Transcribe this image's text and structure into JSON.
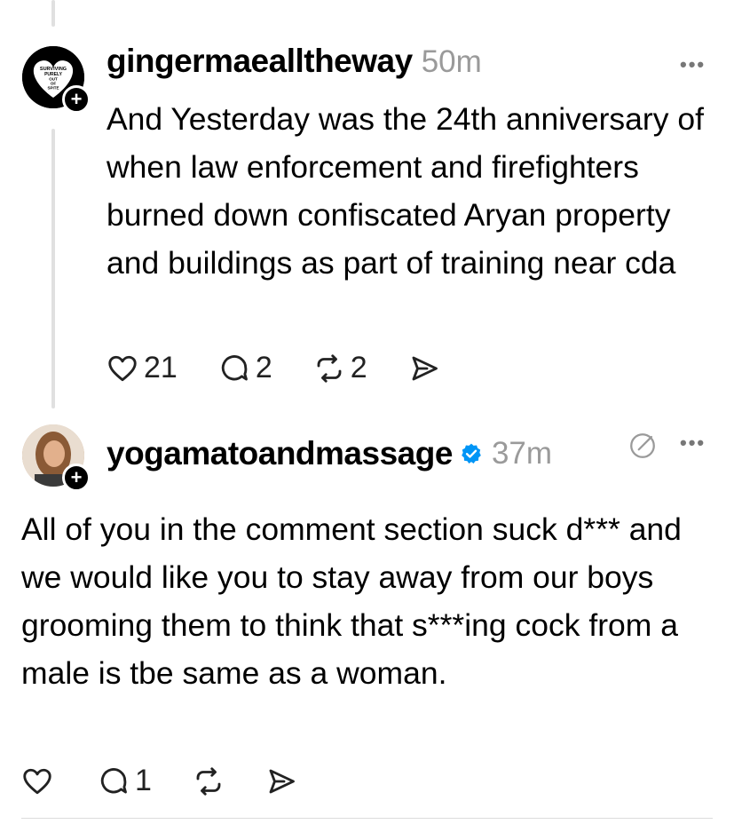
{
  "post1": {
    "username": "gingermaealltheway",
    "time": "50m",
    "more_label": "•••",
    "avatar_text": "SURVIVING PURELY OUT OF SPITE",
    "plus": "+",
    "text": "And Yesterday was the 24th anniversary of when law enforcement and firefighters burned down confiscated Aryan property and buildings as part of training near cda",
    "likes": "21",
    "replies": "2",
    "reposts": "2"
  },
  "post2": {
    "username": "yogamatoandmassage",
    "verified": true,
    "time": "37m",
    "more_label": "•••",
    "plus": "+",
    "text": "All of you in the comment section suck d*** and we would like you to stay away from our boys grooming them to think that s***ing cock from a male is tbe same as a woman.",
    "replies": "1"
  },
  "colors": {
    "accent_verified": "#0095f6",
    "muted": "#9a9a9a",
    "thread_line": "#e0e0e0"
  }
}
